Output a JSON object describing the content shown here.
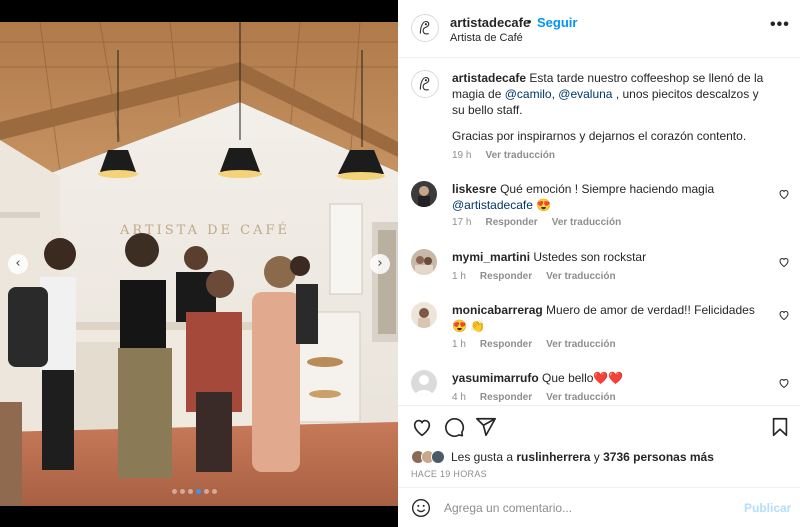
{
  "post": {
    "username": "artistadecafe",
    "follow_label": "Seguir",
    "separator": "•",
    "subtitle": "Artista de Café",
    "more_icon": "more-horizontal-icon",
    "photo": {
      "sign_text": "ARTISTA DE CAFÉ",
      "left_arrow": "‹",
      "right_arrow": "›",
      "carousel_dots": 6,
      "active_dot": 3
    }
  },
  "caption": {
    "username": "artistadecafe",
    "text_1": "Esta tarde nuestro coffeeshop se llenó de la magia de",
    "mention_1": "@camilo",
    "text_2": ",",
    "mention_2": "@evaluna",
    "text_3": ", unos piecitos descalzos y su bello staff.",
    "paragraph_2": "Gracias por inspirarnos y dejarnos el corazón contento.",
    "time": "19 h",
    "translate_label": "Ver traducción"
  },
  "comments": [
    {
      "username": "liskesre",
      "text": "Qué emoción ! Siempre haciendo magia",
      "mention": "@artistadecafe",
      "emoji": "😍",
      "time": "17 h",
      "reply_label": "Responder",
      "translate_label": "Ver traducción"
    },
    {
      "username": "mymi_martini",
      "text": "Ustedes son rockstar",
      "time": "1 h",
      "reply_label": "Responder",
      "translate_label": "Ver traducción"
    },
    {
      "username": "monicabarrerag",
      "text": "Muero de amor de verdad!! Felicidades 😍",
      "emoji": "👏",
      "time": "1 h",
      "reply_label": "Responder",
      "translate_label": "Ver traducción"
    },
    {
      "username": "yasumimarrufo",
      "text": "Que bello❤️❤️",
      "time": "4 h",
      "reply_label": "Responder",
      "translate_label": "Ver traducción"
    }
  ],
  "likes": {
    "prefix": "Les gusta a",
    "user": "ruslinherrera",
    "connector": "y",
    "others": "3736 personas más",
    "time_ago": "HACE 19 HORAS"
  },
  "add_comment": {
    "placeholder": "Agrega un comentario...",
    "post_label": "Publicar"
  },
  "colors": {
    "link_blue": "#0095f6",
    "mention_blue": "#00376b",
    "muted": "#8e8e8e",
    "post_disabled": "#b2dffc"
  }
}
